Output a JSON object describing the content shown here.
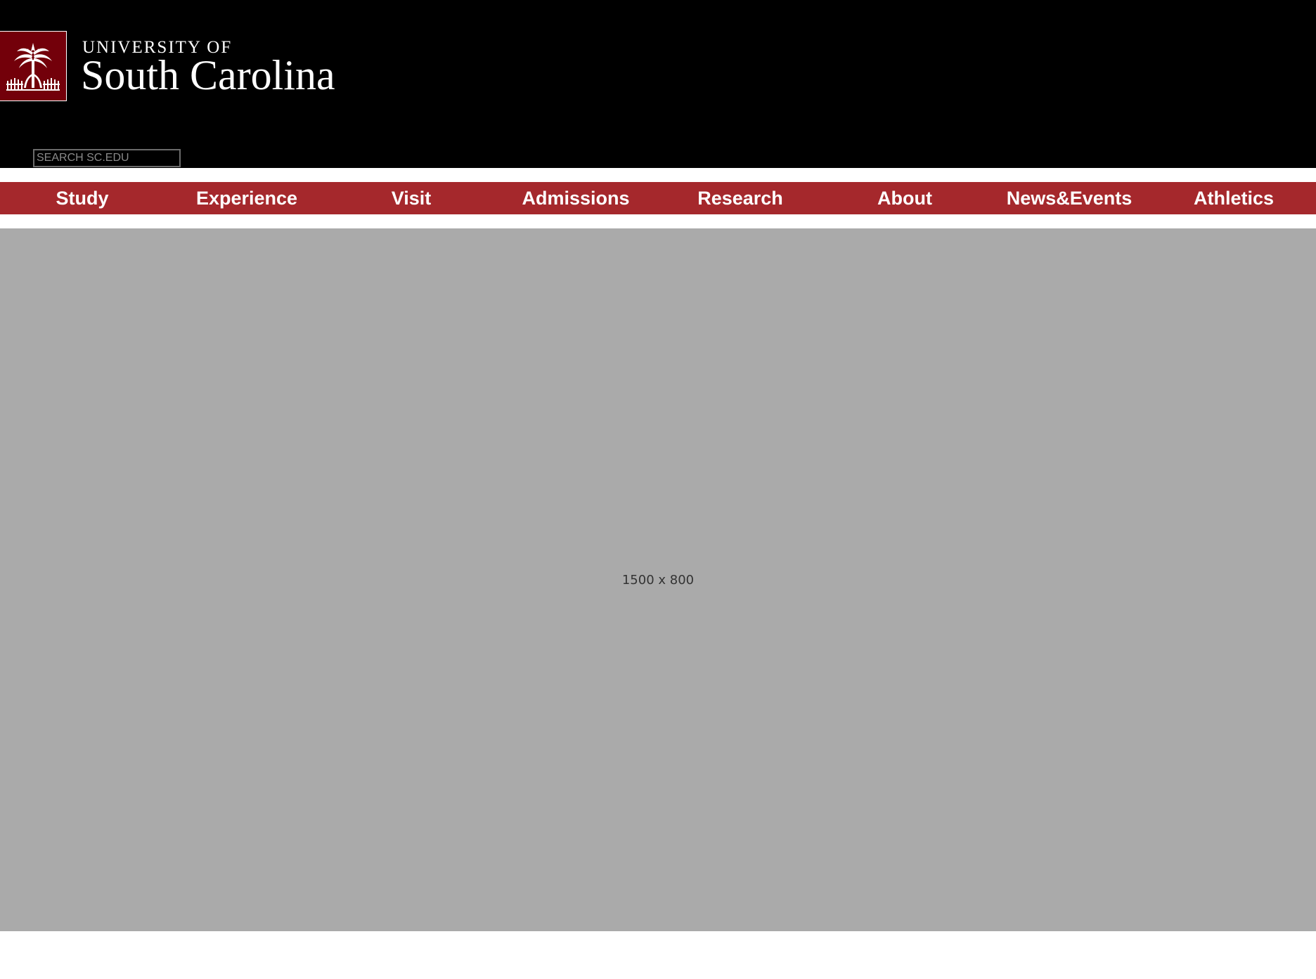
{
  "header": {
    "logo_icon": "palmetto-tree-icon",
    "wordmark_top": "UNIVERSITY OF",
    "wordmark_main": "South Carolina",
    "colors": {
      "background": "#000000",
      "garnet": "#73000a"
    }
  },
  "search": {
    "placeholder": "SEARCH SC.EDU",
    "value": ""
  },
  "nav": {
    "color": "#a5282c",
    "items": [
      {
        "label": "Study"
      },
      {
        "label": "Experience"
      },
      {
        "label": "Visit"
      },
      {
        "label": "Admissions"
      },
      {
        "label": "Research"
      },
      {
        "label": "About"
      },
      {
        "label": "News&Events"
      },
      {
        "label": "Athletics"
      }
    ]
  },
  "hero": {
    "placeholder_label": "1500 x 800",
    "color": "#aaaaaa"
  }
}
